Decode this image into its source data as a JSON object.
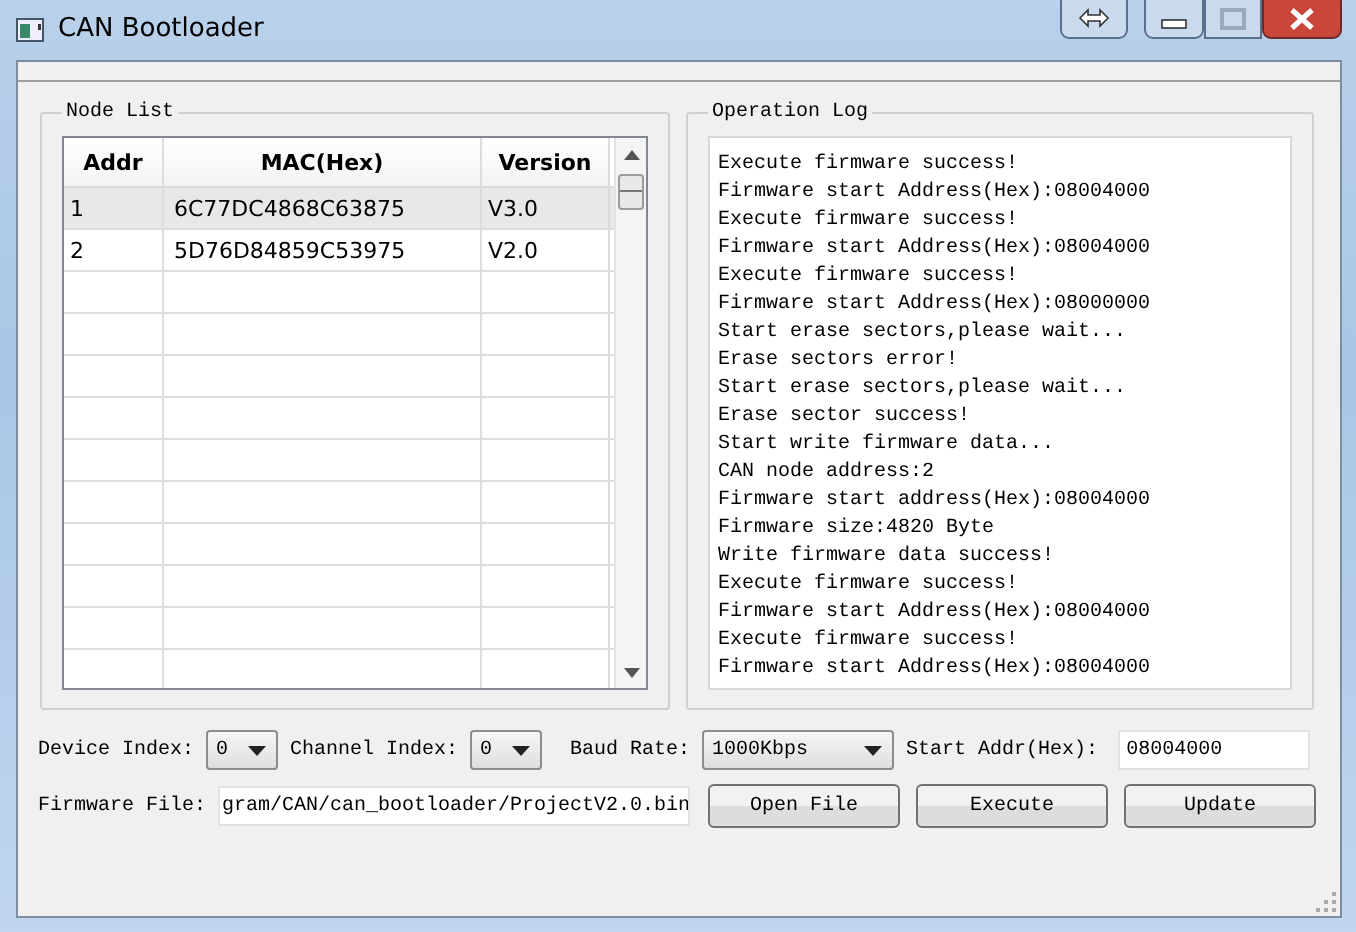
{
  "window": {
    "title": "CAN Bootloader"
  },
  "node_list": {
    "title": "Node List",
    "columns": [
      "Addr",
      "MAC(Hex)",
      "Version"
    ],
    "rows": [
      {
        "cells": [
          "1",
          "6C77DC4868C63875",
          "V3.0"
        ],
        "selected": true
      },
      {
        "cells": [
          "2",
          "5D76D84859C53975",
          "V2.0"
        ],
        "selected": false
      }
    ]
  },
  "operation_log": {
    "title": "Operation Log",
    "lines": [
      "Execute firmware success!",
      "Firmware start Address(Hex):08004000",
      "Execute firmware success!",
      "Firmware start Address(Hex):08004000",
      "Execute firmware success!",
      "Firmware start Address(Hex):08000000",
      "Start erase sectors,please wait...",
      "Erase sectors error!",
      "Start erase sectors,please wait...",
      "Erase sector success!",
      "Start write firmware data...",
      "CAN node address:2",
      "Firmware start address(Hex):08004000",
      "Firmware size:4820 Byte",
      "Write firmware data success!",
      "Execute firmware success!",
      "Firmware start Address(Hex):08004000",
      "Execute firmware success!",
      "Firmware start Address(Hex):08004000"
    ]
  },
  "control_rows": [
    [
      {
        "kind": "label",
        "text": "Device Index:"
      },
      {
        "kind": "combo",
        "value": "0"
      },
      {
        "kind": "label",
        "text": "Channel Index:"
      },
      {
        "kind": "combo",
        "value": "0"
      },
      {
        "kind": "label",
        "text": "Baud Rate:"
      },
      {
        "kind": "combo",
        "value": "1000Kbps"
      },
      {
        "kind": "label",
        "text": "Start Addr(Hex):"
      },
      {
        "kind": "field",
        "value": "08004000"
      }
    ],
    [
      {
        "kind": "label",
        "text": "Firmware File:"
      },
      {
        "kind": "field",
        "value": "gram/CAN/can_bootloader/ProjectV2.0.bin"
      },
      {
        "kind": "button",
        "text": "Open File"
      },
      {
        "kind": "button",
        "text": "Execute"
      },
      {
        "kind": "button",
        "text": "Update"
      }
    ]
  ]
}
